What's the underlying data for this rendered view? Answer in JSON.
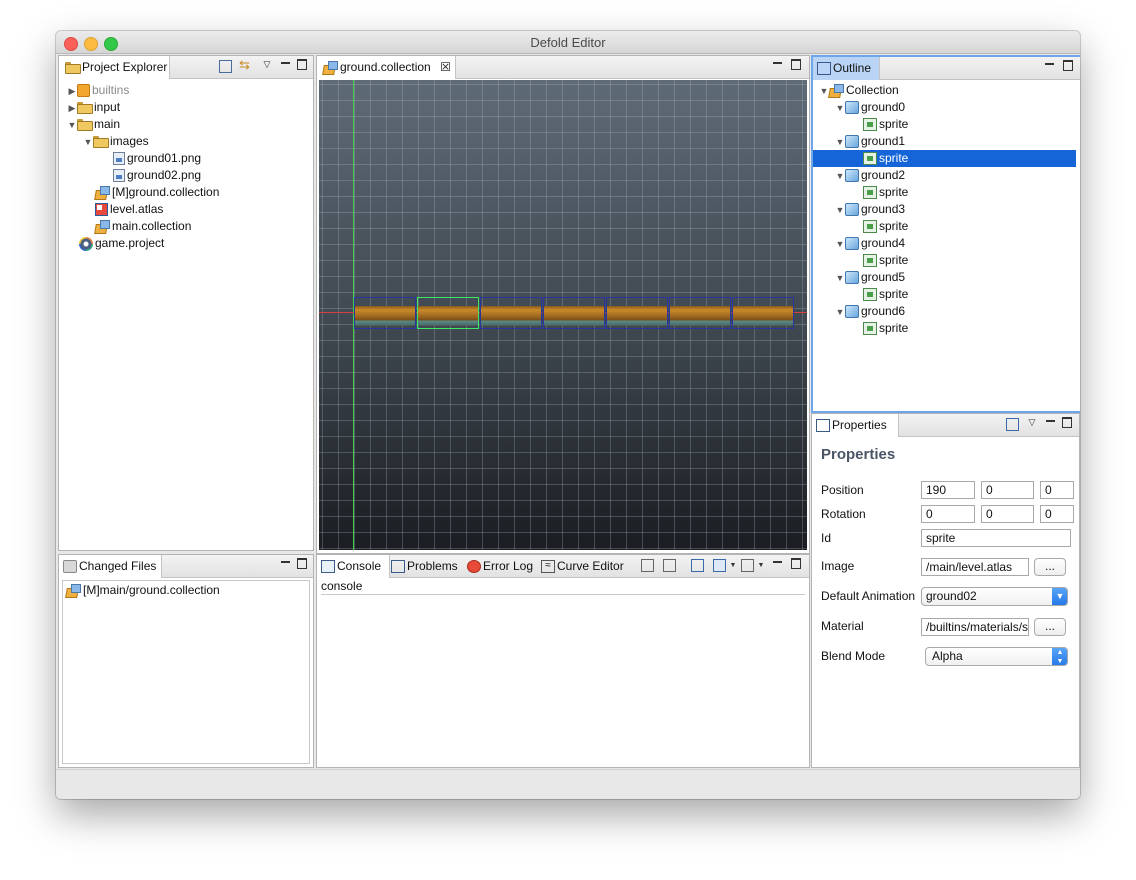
{
  "window": {
    "title": "Defold Editor"
  },
  "project_explorer": {
    "tab_label": "Project Explorer",
    "items": [
      {
        "label": "builtins",
        "icon": "builtins-icon"
      },
      {
        "label": "input",
        "icon": "folder-icon"
      },
      {
        "label": "main",
        "icon": "folder-icon"
      },
      {
        "label": "images",
        "icon": "folder-icon"
      },
      {
        "label": "ground01.png",
        "icon": "image-file-icon"
      },
      {
        "label": "ground02.png",
        "icon": "image-file-icon"
      },
      {
        "label": "[M]ground.collection",
        "icon": "collection-icon"
      },
      {
        "label": "level.atlas",
        "icon": "atlas-icon"
      },
      {
        "label": "main.collection",
        "icon": "collection-icon"
      },
      {
        "label": "game.project",
        "icon": "project-settings-icon"
      }
    ]
  },
  "changed_files": {
    "tab_label": "Changed Files",
    "items": [
      {
        "label": "[M]main/ground.collection"
      }
    ]
  },
  "editor": {
    "tab_label": "ground.collection",
    "close_glyph": "☒"
  },
  "scene": {
    "tiles": 7,
    "selected_tile": 1
  },
  "bottom_tabs": {
    "tabs": [
      "Console",
      "Problems",
      "Error Log",
      "Curve Editor"
    ],
    "console_header": "console"
  },
  "outline": {
    "tab_label": "Outline",
    "root": "Collection",
    "children": [
      {
        "label": "ground0",
        "child": "sprite"
      },
      {
        "label": "ground1",
        "child": "sprite"
      },
      {
        "label": "ground2",
        "child": "sprite"
      },
      {
        "label": "ground3",
        "child": "sprite"
      },
      {
        "label": "ground4",
        "child": "sprite"
      },
      {
        "label": "ground5",
        "child": "sprite"
      },
      {
        "label": "ground6",
        "child": "sprite"
      }
    ],
    "selected": "ground1/sprite"
  },
  "properties": {
    "tab_label": "Properties",
    "heading": "Properties",
    "position": {
      "label": "Position",
      "x": "190",
      "y": "0",
      "z": "0"
    },
    "rotation": {
      "label": "Rotation",
      "x": "0",
      "y": "0",
      "z": "0"
    },
    "id": {
      "label": "Id",
      "value": "sprite"
    },
    "image": {
      "label": "Image",
      "value": "/main/level.atlas",
      "button": "..."
    },
    "default_animation": {
      "label": "Default Animation",
      "value": "ground02"
    },
    "material": {
      "label": "Material",
      "value": "/builtins/materials/s",
      "button": "..."
    },
    "blend_mode": {
      "label": "Blend Mode",
      "value": "Alpha"
    }
  },
  "colors": {
    "selection": "#1565d8",
    "accent": "#2276e8",
    "y_axis": "#3fd04a",
    "x_axis": "#d84040"
  }
}
